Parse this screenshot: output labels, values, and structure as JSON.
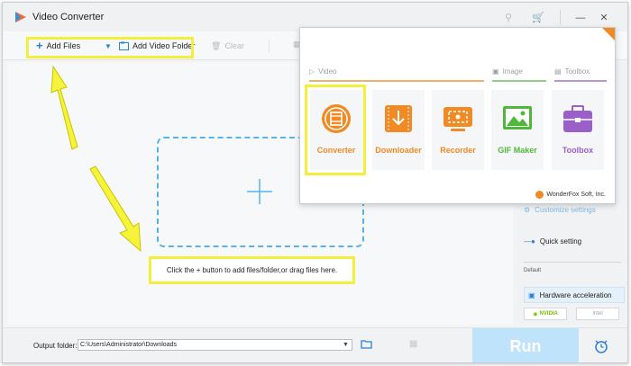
{
  "window": {
    "title": "Video Converter",
    "title_icons": [
      "key-icon",
      "cart-icon",
      "minimize-icon",
      "close-icon"
    ]
  },
  "toolbar": {
    "add_files_label": "Add Files",
    "add_video_folder_label": "Add Video Folder",
    "clear_label": "Clear"
  },
  "workarea": {
    "hint_text": "Click the + button to add files/folder,or drag files here."
  },
  "settings_panel": {
    "customize_label": "Customize settings",
    "quick_setting_label": "Quick setting",
    "default_label": "Default",
    "hw_accel_label": "Hardware acceleration",
    "gpu_nvidia": "NVIDIA",
    "gpu_intel": "Intel"
  },
  "bottom": {
    "output_folder_label": "Output folder:",
    "output_folder_value": "C:\\Users\\Administrator\\Downloads",
    "run_label": "Run"
  },
  "popup": {
    "categories": [
      {
        "label": "Video",
        "icon": "video-icon",
        "color": "#f0b36c"
      },
      {
        "label": "Image",
        "icon": "image-icon",
        "color": "#8fd08a"
      },
      {
        "label": "Toolbox",
        "icon": "toolbox-icon",
        "color": "#b995d9"
      }
    ],
    "tiles": [
      {
        "label": "Converter",
        "color": "#f08a24",
        "icon": "converter-icon"
      },
      {
        "label": "Downloader",
        "color": "#f08a24",
        "icon": "downloader-icon"
      },
      {
        "label": "Recorder",
        "color": "#f08a24",
        "icon": "recorder-icon"
      },
      {
        "label": "GIF Maker",
        "color": "#4fb83b",
        "icon": "gif-maker-icon"
      },
      {
        "label": "Toolbox",
        "color": "#9b5fc8",
        "icon": "toolbox-icon"
      }
    ],
    "brand": "WonderFox Soft, Inc."
  }
}
